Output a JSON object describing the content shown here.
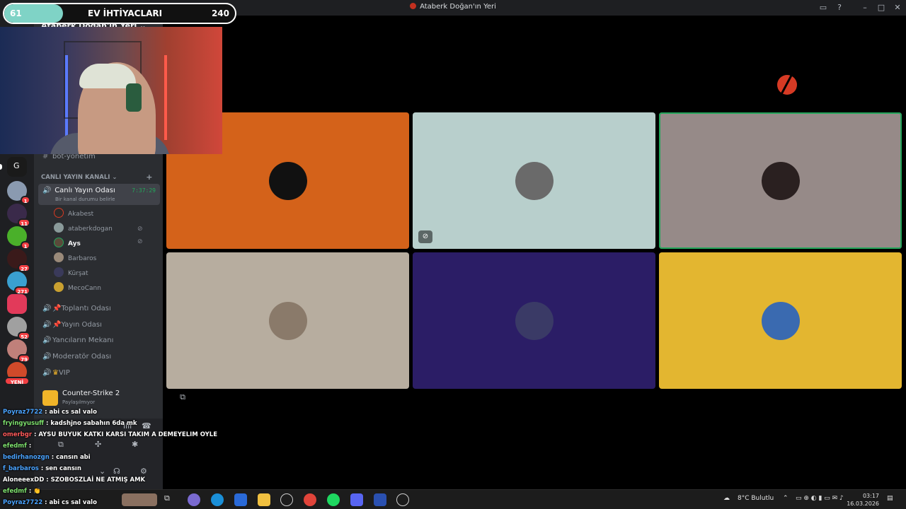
{
  "window": {
    "title": "Ataberk Doğan'ın Yeri",
    "icons": [
      "inbox-icon",
      "help-icon",
      "minimize-icon",
      "maximize-icon",
      "close-icon"
    ]
  },
  "overlay_progress": {
    "current": "61",
    "label": "EV İHTİYACLARI",
    "target": "240",
    "fraction": 0.254,
    "color": "#7fd3c6"
  },
  "server_header": {
    "name": "Ataberk Doğan'ın Yeri ⌄"
  },
  "server_badges": [
    "1",
    "11",
    "1",
    "27",
    "271",
    "52",
    "79",
    "YENİ"
  ],
  "channels": {
    "bot_channel": "bot-yönetim",
    "category": "CANLI YAYIN KANALI",
    "category_add": "+",
    "active": {
      "name": "Canlı Yayın Odası",
      "timer": "7:37:29",
      "status": "Bir kanal durumu belirle"
    },
    "members": [
      {
        "name": "Akabest",
        "color": "#2b2b2b"
      },
      {
        "name": "ataberkdogan",
        "color": "#8a9a9a"
      },
      {
        "name": "Ays",
        "color": "#5a4a3a"
      },
      {
        "name": "Barbaros",
        "color": "#9a8a7a"
      },
      {
        "name": "Kürşat",
        "color": "#3a3a5a"
      },
      {
        "name": "MecoCann",
        "color": "#c9a030"
      }
    ],
    "others": [
      "Toplantı Odası",
      "Yayın Odası",
      "Yancıların Mekanı",
      "Moderatör Odası",
      "VIP"
    ]
  },
  "activity": {
    "game": "Counter-Strike 2",
    "status": "Paylaşılmıyor"
  },
  "tiles": [
    {
      "bg": "#d4621a",
      "avatar": "#111111",
      "muted": false,
      "speaking": false
    },
    {
      "bg": "#b8cfcc",
      "avatar": "#6a6a6a",
      "muted": true,
      "speaking": false
    },
    {
      "bg": "#968a88",
      "avatar": "#2a2020",
      "muted": false,
      "speaking": true
    },
    {
      "bg": "#b7ad9f",
      "avatar": "#8a7a6a",
      "muted": false,
      "speaking": false
    },
    {
      "bg": "#2b1d66",
      "avatar": "#3a3a66",
      "muted": false,
      "speaking": false
    },
    {
      "bg": "#e3b630",
      "avatar": "#3a6ab0",
      "muted": false,
      "speaking": false
    }
  ],
  "chat": [
    {
      "user": "Poyraz7722",
      "user_color": "#4aa3ff",
      "message": "abi cs sal valo"
    },
    {
      "user": "fryingyusuff",
      "user_color": "#7ee06e",
      "message": "kadshjno sabahın 6da mk"
    },
    {
      "user": "omerbgr",
      "user_color": "#ff5a5a",
      "message": "AYSU BUYUK KATKI KARSI TAKIM A DEMEYELIM OYLE"
    },
    {
      "user": "efedmf",
      "user_color": "#7ee06e",
      "message": ""
    },
    {
      "user": "bedirhanozgn",
      "user_color": "#4aa3ff",
      "message": "cansın abi"
    },
    {
      "user": "f_barbaros",
      "user_color": "#4aa3ff",
      "message": "sen cansın"
    },
    {
      "user": "AloneeexDD",
      "user_color": "#ffffff",
      "message": "SZOBOSZLAİ NE ATMIŞ AMK"
    },
    {
      "user": "efedmf",
      "user_color": "#7ee06e",
      "message": "👏"
    },
    {
      "user": "Poyraz7722",
      "user_color": "#4aa3ff",
      "message": "abi cs sal valo"
    }
  ],
  "taskbar": {
    "weather": "8°C Bulutlu",
    "time": "03:17",
    "date": "16.03.2026"
  }
}
